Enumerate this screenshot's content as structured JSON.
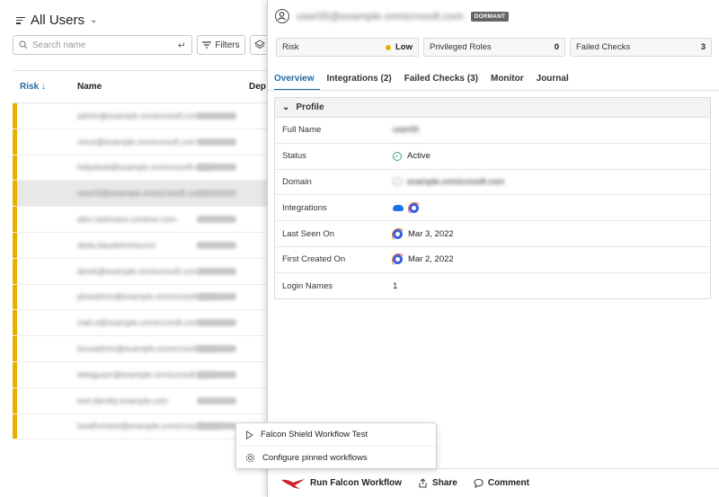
{
  "list": {
    "title": "All Users",
    "search_placeholder": "Search name",
    "filters_label": "Filters",
    "columns": {
      "risk": "Risk",
      "name": "Name",
      "department": "Dep"
    },
    "rows": [
      {
        "name": "admin@example.onmicrosoft.com",
        "selected": false
      },
      {
        "name": "vince@example.onmicrosoft.com",
        "selected": false
      },
      {
        "name": "helpdesk@example.onmicrosoft.com",
        "selected": false
      },
      {
        "name": "user00@example.onmicrosoft.com",
        "selected": true
      },
      {
        "name": "alex.hartmann.contoso.com",
        "selected": false
      },
      {
        "name": "abda.baudehomecom",
        "selected": false
      },
      {
        "name": "derek@example.onmicrosoft.com",
        "selected": false
      },
      {
        "name": "jdoeadmin@example.onmicrosoft.com",
        "selected": false
      },
      {
        "name": "mail.a@example.onmicrosoft.com",
        "selected": false
      },
      {
        "name": "linuxadmin@example.onmicrosoft.com",
        "selected": false
      },
      {
        "name": "deleguser@example.onmicrosoft.com",
        "selected": false
      },
      {
        "name": "test.identity.example.com",
        "selected": false
      },
      {
        "name": "healthcheck@example.onmicrosoft.com",
        "selected": false
      }
    ]
  },
  "detail": {
    "email": "user00@example.onmicrosoft.com",
    "status_badge": "DORMANT",
    "summary": {
      "risk_label": "Risk",
      "risk_value": "Low",
      "privileged_label": "Privileged Roles",
      "privileged_value": "0",
      "failed_label": "Failed Checks",
      "failed_value": "3"
    },
    "tabs": [
      "Overview",
      "Integrations (2)",
      "Failed Checks (3)",
      "Monitor",
      "Journal"
    ],
    "profile": {
      "header": "Profile",
      "rows": [
        {
          "label": "Full Name",
          "value": "user00"
        },
        {
          "label": "Status",
          "value": "Active"
        },
        {
          "label": "Domain",
          "value": "example.onmicrosoft.com"
        },
        {
          "label": "Integrations",
          "value": ""
        },
        {
          "label": "Last Seen On",
          "value": "Mar 3, 2022"
        },
        {
          "label": "First Created On",
          "value": "Mar 2, 2022"
        },
        {
          "label": "Login Names",
          "value": "1"
        }
      ]
    },
    "bottom": {
      "run_workflow": "Run Falcon Workflow",
      "share": "Share",
      "comment": "Comment"
    }
  },
  "popup": {
    "item1": "Falcon Shield Workflow Test",
    "item2": "Configure pinned workflows"
  },
  "colors": {
    "accent": "#1f6aa5",
    "risk_low": "#e6b000",
    "falcon_red": "#d0202e"
  }
}
